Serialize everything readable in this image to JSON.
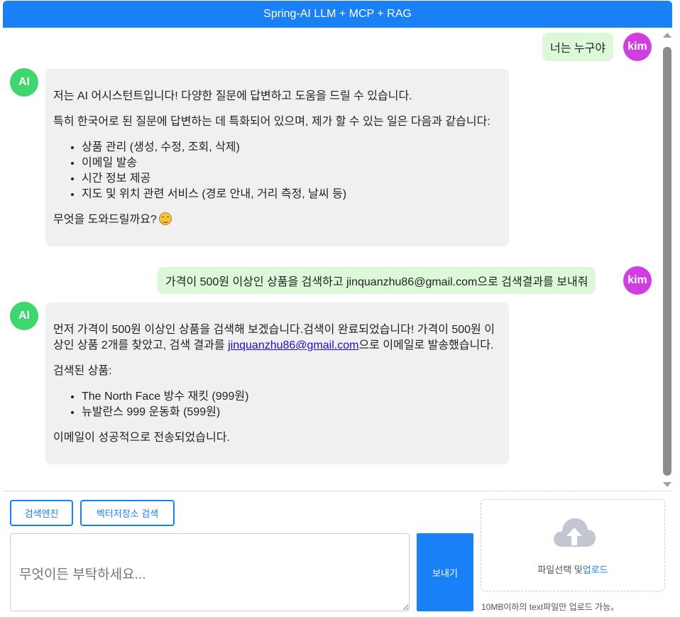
{
  "header": {
    "title": "Spring-AI LLM + MCP + RAG"
  },
  "colors": {
    "accent": "#1a80f5",
    "user_avatar": "#d13ee0",
    "ai_avatar": "#3ed66e",
    "user_bubble": "#dcf8d8",
    "ai_bubble": "#f0f0f0"
  },
  "messages": {
    "m1": {
      "sender": "kim",
      "text": "너는 누구야"
    },
    "m2": {
      "sender": "AI",
      "p1": "저는 AI 어시스턴트입니다! 다양한 질문에 답변하고 도움을 드릴 수 있습니다.",
      "p2": "특히 한국어로 된 질문에 답변하는 데 특화되어 있으며, 제가 할 수 있는 일은 다음과 같습니다:",
      "items": [
        "상품 관리 (생성, 수정, 조회, 삭제)",
        "이메일 발송",
        "시간 정보 제공",
        "지도 및 위치 관련 서비스 (경로 안내, 거리 측정, 날씨 등)"
      ],
      "p3": "무엇을 도와드릴까요?",
      "emoji": "smiling-face-icon"
    },
    "m3": {
      "sender": "kim",
      "text": "가격이 500원 이상인 상품을 검색하고 jinquanzhu86@gmail.com으로 검색결과를 보내줘"
    },
    "m4": {
      "sender": "AI",
      "p1a": "먼저 가격이 500원 이상인 상품을 검색해 보겠습니다.검색이 완료되었습니다! 가격이 500원 이상인 상품 2개를 찾았고, 검색 결과를 ",
      "email": "jinquanzhu86@gmail.com",
      "p1b": "으로 이메일로 발송했습니다.",
      "p2": "검색된 상품:",
      "items": [
        "The North Face 방수 재킷 (999원)",
        "뉴발란스 999 운동화 (599원)"
      ],
      "p3": "이메일이 성공적으로 전송되었습니다."
    }
  },
  "toolbar": {
    "search_engine": "검색엔진",
    "vector_search": "벡터저장소 검색"
  },
  "composer": {
    "placeholder": "무엇이든 부탁하세요...",
    "send": "보내기"
  },
  "upload": {
    "label": "파일선택 및",
    "link": "업로드",
    "note": "10MB이하의 text파일만 업로드 가능。",
    "icon": "cloud-upload-icon"
  }
}
